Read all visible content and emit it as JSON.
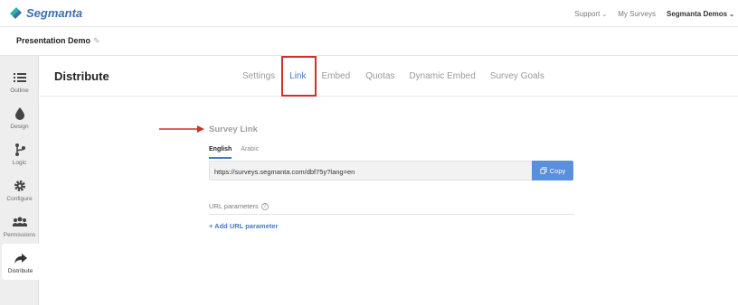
{
  "brand": {
    "name": "Segmanta"
  },
  "topnav": {
    "support": "Support",
    "my_surveys": "My Surveys",
    "account": "Segmanta Demos"
  },
  "project": {
    "title": "Presentation Demo"
  },
  "sidebar": {
    "items": [
      {
        "label": "Outline",
        "icon": "list-icon"
      },
      {
        "label": "Design",
        "icon": "droplet-icon"
      },
      {
        "label": "Logic",
        "icon": "branch-icon"
      },
      {
        "label": "Configure",
        "icon": "gear-icon"
      },
      {
        "label": "Permissions",
        "icon": "users-icon"
      },
      {
        "label": "Distribute",
        "icon": "share-arrow-icon",
        "active": true
      }
    ]
  },
  "page": {
    "title": "Distribute",
    "tabs": [
      "Settings",
      "Link",
      "Embed",
      "Quotas",
      "Dynamic Embed",
      "Survey Goals"
    ],
    "active_tab": "Link"
  },
  "survey_link": {
    "title": "Survey Link",
    "languages": [
      "English",
      "Arabic"
    ],
    "active_language": "English",
    "url": "https://surveys.segmanta.com/dbf75y?lang=en",
    "copy_label": "Copy"
  },
  "url_parameters": {
    "label": "URL parameters",
    "add_label": "+ Add URL parameter"
  },
  "colors": {
    "accent": "#4a78c7",
    "button": "#5a8fdc",
    "highlight": "#d32f2f"
  }
}
